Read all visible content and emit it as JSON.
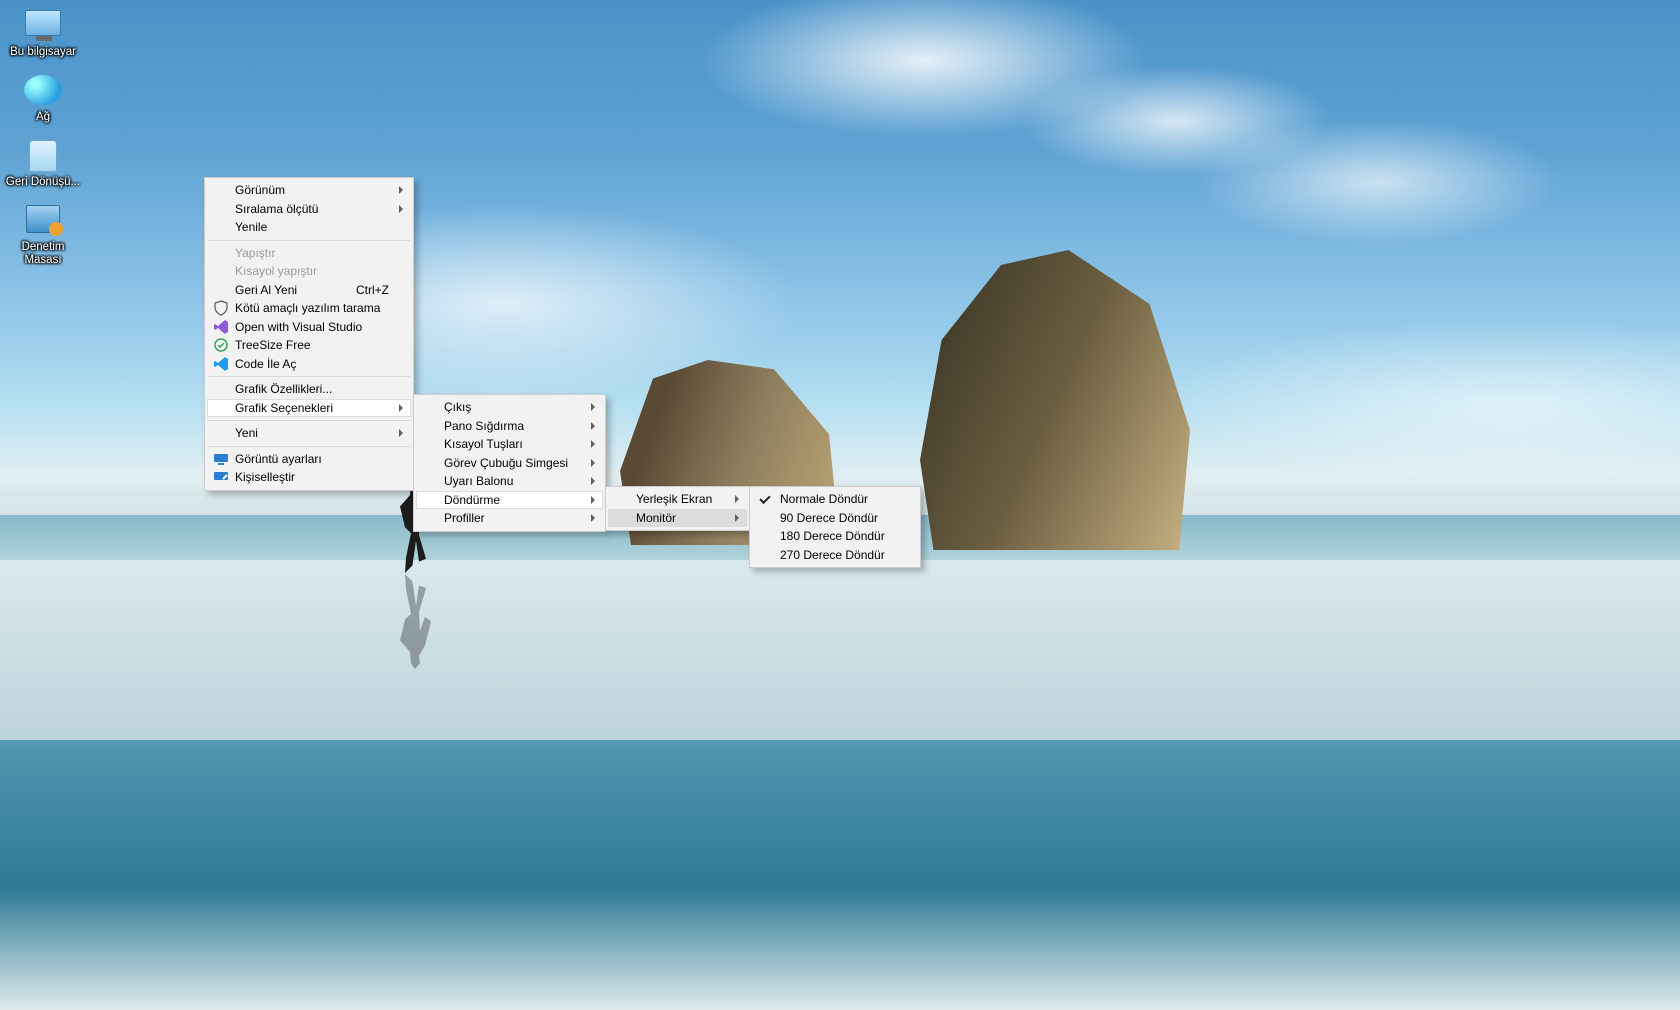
{
  "desktop_icons": [
    {
      "name": "this-pc",
      "label": "Bu bilgisayar"
    },
    {
      "name": "network",
      "label": "Ağ"
    },
    {
      "name": "recycle-bin",
      "label": "Geri Dönüşü..."
    },
    {
      "name": "control-panel",
      "label": "Denetim Masası"
    }
  ],
  "context_menu": {
    "view": "Görünüm",
    "sort_by": "Sıralama ölçütü",
    "refresh": "Yenile",
    "paste": "Yapıştır",
    "paste_shortcut": "Kısayol yapıştır",
    "undo_new": "Geri Al Yeni",
    "undo_shortcut": "Ctrl+Z",
    "malware_scan": "Kötü amaçlı yazılım tarama",
    "open_vs": "Open with Visual Studio",
    "treesize": "TreeSize Free",
    "open_code": "Code İle Aç",
    "gfx_props": "Grafik Özellikleri...",
    "gfx_opts": "Grafik Seçenekleri",
    "new": "Yeni",
    "display_settings": "Görüntü ayarları",
    "personalize": "Kişiselleştir"
  },
  "gfx_submenu": {
    "output": "Çıkış",
    "panel_fit": "Pano Sığdırma",
    "hotkeys": "Kısayol Tuşları",
    "taskbar_icon": "Görev Çubuğu Simgesi",
    "balloon": "Uyarı Balonu",
    "rotation": "Döndürme",
    "profiles": "Profiller"
  },
  "rotation_submenu": {
    "builtin": "Yerleşik Ekran",
    "monitor": "Monitör"
  },
  "rotation_options": {
    "normal": "Normale Döndür",
    "r90": "90 Derece Döndür",
    "r180": "180 Derece Döndür",
    "r270": "270 Derece Döndür"
  }
}
